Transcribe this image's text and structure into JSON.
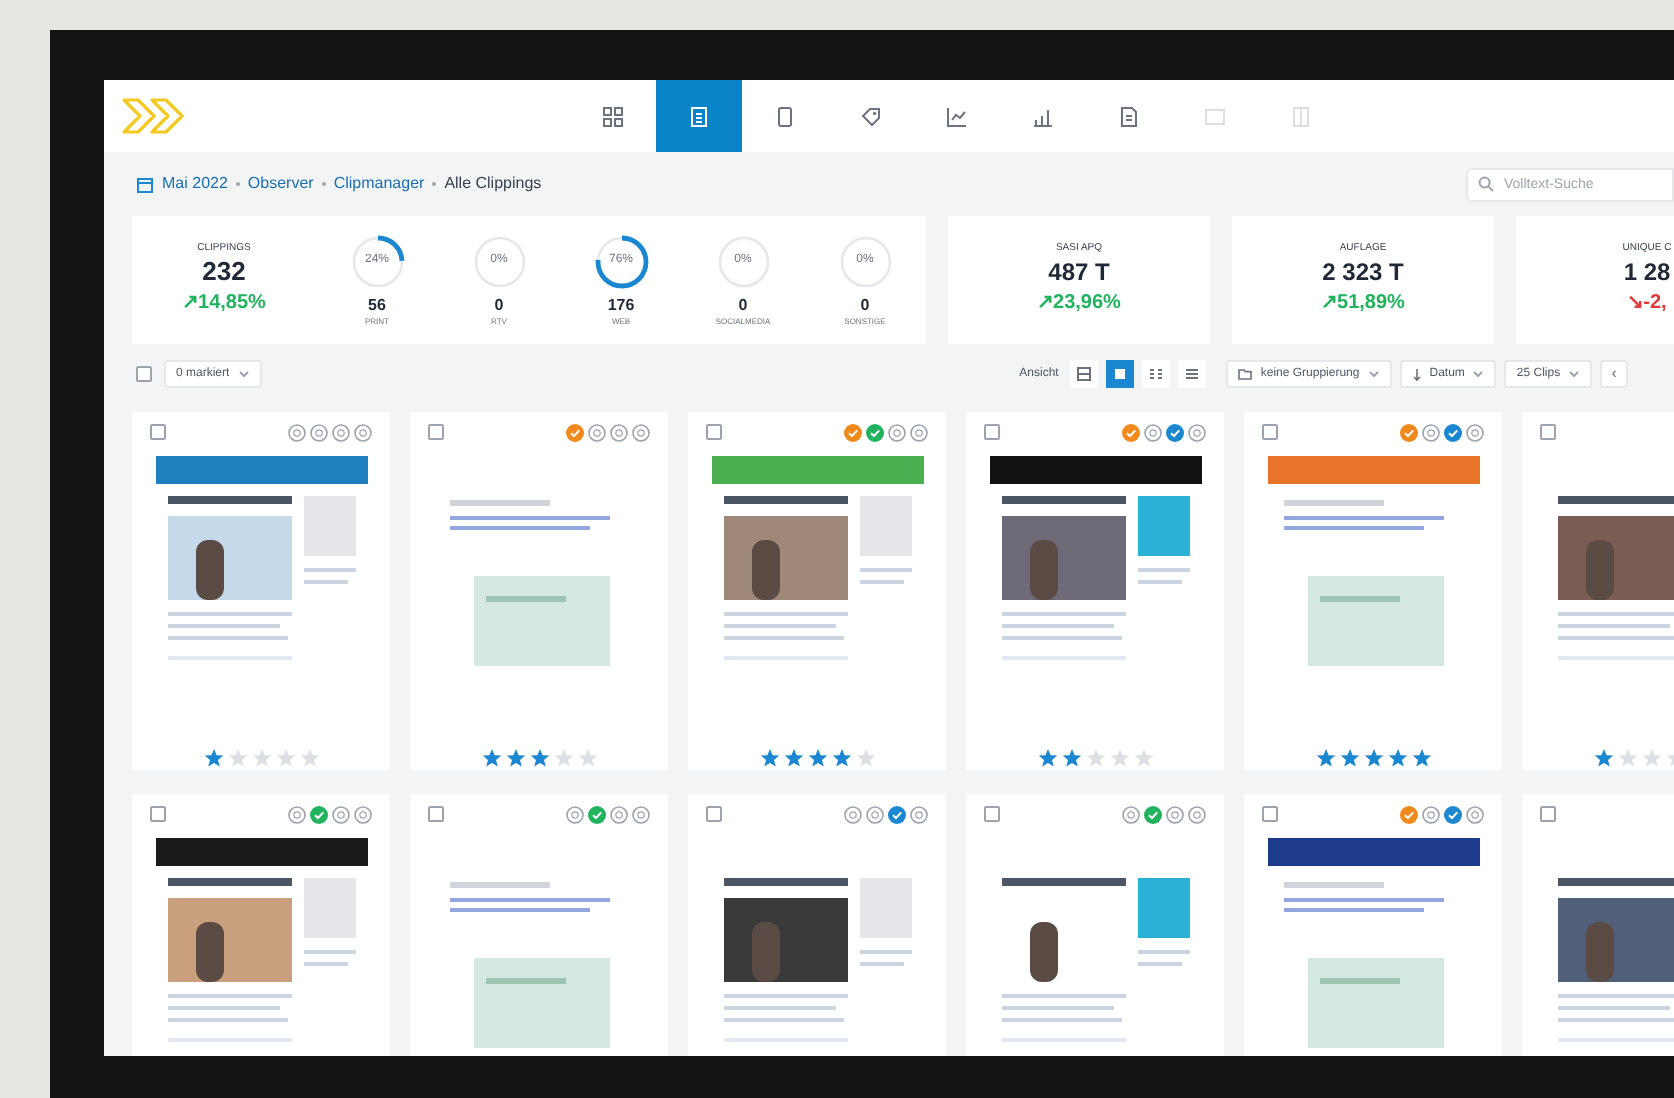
{
  "nav": {
    "tabs": [
      {
        "selected": false,
        "disabled": false
      },
      {
        "selected": true,
        "disabled": false
      },
      {
        "selected": false,
        "disabled": false
      },
      {
        "selected": false,
        "disabled": false
      },
      {
        "selected": false,
        "disabled": false
      },
      {
        "selected": false,
        "disabled": false
      },
      {
        "selected": false,
        "disabled": false
      },
      {
        "selected": false,
        "disabled": true
      },
      {
        "selected": false,
        "disabled": true
      }
    ]
  },
  "breadcrumb": [
    {
      "label": "Mai 2022",
      "link": true
    },
    {
      "label": "Observer",
      "link": true
    },
    {
      "label": "Clipmanager",
      "link": true
    },
    {
      "label": "Alle Clippings",
      "link": false
    }
  ],
  "search": {
    "placeholder": "Volltext-Suche"
  },
  "summary": {
    "label": "CLIPPINGS",
    "value": "232",
    "negative": false,
    "change": "↗14,85%"
  },
  "media": [
    {
      "percent": "24%",
      "level": 0.24,
      "value": "56",
      "label": "PRINT"
    },
    {
      "percent": "0%",
      "level": 0,
      "value": "0",
      "label": "RTV"
    },
    {
      "percent": "76%",
      "level": 0.76,
      "value": "176",
      "label": "WEB"
    },
    {
      "percent": "0%",
      "level": 0,
      "value": "0",
      "label": "SOCIALMEDIA"
    },
    {
      "percent": "0%",
      "level": 0,
      "value": "0",
      "label": "SONSTIGE"
    }
  ],
  "kpis": [
    {
      "label": "SASI APQ",
      "value": "487 T",
      "negative": false,
      "change": "↗23,96%"
    },
    {
      "label": "AUFLAGE",
      "value": "2 323 T",
      "negative": false,
      "change": "↗51,89%"
    },
    {
      "label": "UNIQUE C",
      "value": "1 28",
      "negative": true,
      "change": "↘-2,"
    }
  ],
  "toolbar": {
    "checked": false,
    "marked": "0 markiert",
    "view_label": "Ansicht",
    "views": [
      {
        "selected": false
      },
      {
        "selected": true
      },
      {
        "selected": false
      },
      {
        "selected": false
      }
    ],
    "grouping": "keine Gruppierung",
    "sort": "Datum",
    "page_size": "25 Clips",
    "prev": "‹"
  },
  "card_rows": [
    [
      {
        "checked": false,
        "badges": [
          {
            "on": false
          },
          {
            "on": false
          },
          {
            "on": false
          },
          {
            "on": false
          }
        ],
        "stars": 1
      },
      {
        "checked": false,
        "badges": [
          {
            "on": true,
            "color": "#f08a1c"
          },
          {
            "on": false
          },
          {
            "on": false
          },
          {
            "on": false
          }
        ],
        "stars": 3
      },
      {
        "checked": false,
        "badges": [
          {
            "on": true,
            "color": "#f08a1c"
          },
          {
            "on": true,
            "color": "#22b35e"
          },
          {
            "on": false
          },
          {
            "on": false
          }
        ],
        "stars": 4
      },
      {
        "checked": false,
        "badges": [
          {
            "on": true,
            "color": "#f08a1c"
          },
          {
            "on": false
          },
          {
            "on": true,
            "color": "#1b87d0"
          },
          {
            "on": false
          }
        ],
        "stars": 2
      },
      {
        "checked": false,
        "badges": [
          {
            "on": true,
            "color": "#f08a1c"
          },
          {
            "on": false
          },
          {
            "on": true,
            "color": "#1b87d0"
          },
          {
            "on": false
          }
        ],
        "stars": 5
      },
      {
        "checked": false,
        "stars": 1
      }
    ],
    [
      {
        "checked": false,
        "badges": [
          {
            "on": false
          },
          {
            "on": true,
            "color": "#22b35e"
          },
          {
            "on": false
          },
          {
            "on": false
          }
        ]
      },
      {
        "checked": false,
        "badges": [
          {
            "on": false
          },
          {
            "on": true,
            "color": "#22b35e"
          },
          {
            "on": false
          },
          {
            "on": false
          }
        ]
      },
      {
        "checked": false,
        "badges": [
          {
            "on": false
          },
          {
            "on": false
          },
          {
            "on": true,
            "color": "#1b87d0"
          },
          {
            "on": false
          }
        ]
      },
      {
        "checked": false,
        "badges": [
          {
            "on": false
          },
          {
            "on": true,
            "color": "#22b35e"
          },
          {
            "on": false
          },
          {
            "on": false
          }
        ]
      },
      {
        "checked": false,
        "badges": [
          {
            "on": true,
            "color": "#f08a1c"
          },
          {
            "on": false
          },
          {
            "on": true,
            "color": "#1b87d0"
          },
          {
            "on": false
          }
        ]
      },
      {
        "checked": false
      }
    ]
  ]
}
